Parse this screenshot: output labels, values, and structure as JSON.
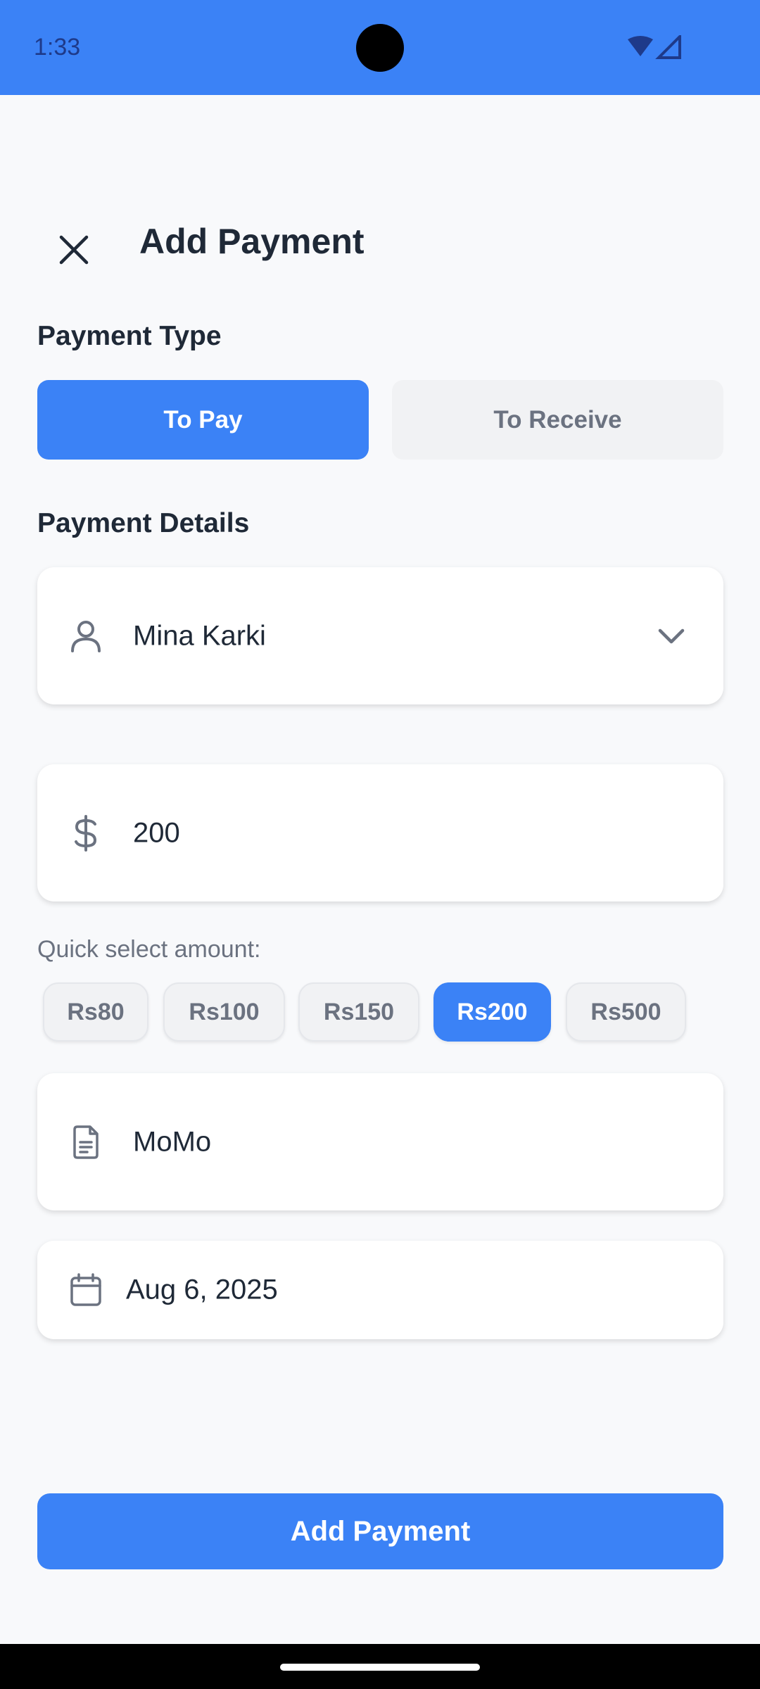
{
  "status_bar": {
    "time": "1:33"
  },
  "header": {
    "title": "Add Payment",
    "close_icon": "close-icon"
  },
  "payment_type": {
    "label": "Payment Type",
    "options": [
      "To Pay",
      "To Receive"
    ],
    "selected": "To Pay"
  },
  "payment_details": {
    "label": "Payment Details",
    "person": {
      "value": "Mina Karki",
      "icon": "person-icon"
    },
    "amount": {
      "value": "200",
      "icon": "dollar-icon"
    },
    "quick_select": {
      "label": "Quick select amount:",
      "chips": [
        "Rs80",
        "Rs100",
        "Rs150",
        "Rs200",
        "Rs500"
      ],
      "selected": "Rs200"
    },
    "note": {
      "value": "MoMo",
      "icon": "document-icon"
    },
    "date": {
      "value": "Aug 6, 2025",
      "icon": "calendar-icon"
    }
  },
  "submit": {
    "label": "Add Payment"
  },
  "colors": {
    "accent": "#3b82f6",
    "background": "#f8f9fb",
    "chip_bg": "#f1f2f4"
  }
}
